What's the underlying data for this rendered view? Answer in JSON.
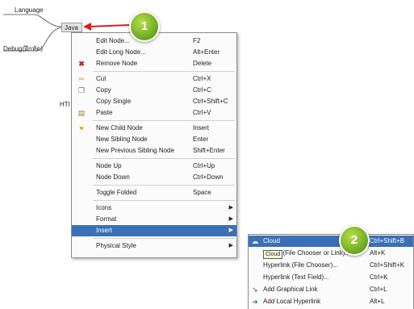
{
  "mindmap": {
    "nodes": {
      "language": "Language",
      "java": "Java",
      "debug": "Debug(ฝึกหัด)",
      "html_partial": "HTI"
    }
  },
  "annotations": {
    "badge1": "1",
    "badge2": "2",
    "arrow_color": "#d62020"
  },
  "context_menu": {
    "items": [
      {
        "label": "Edit Node...",
        "shortcut": "F2",
        "icon": ""
      },
      {
        "label": "Edit Long Node...",
        "shortcut": "Alt+Enter",
        "icon": ""
      },
      {
        "label": "Remove Node",
        "shortcut": "Delete",
        "icon": "remove-icon"
      },
      {
        "label": "Cut",
        "shortcut": "Ctrl+X",
        "icon": "cut-icon"
      },
      {
        "label": "Copy",
        "shortcut": "Ctrl+C",
        "icon": "copy-icon"
      },
      {
        "label": "Copy Single",
        "shortcut": "Ctrl+Shift+C",
        "icon": ""
      },
      {
        "label": "Paste",
        "shortcut": "Ctrl+V",
        "icon": "paste-icon"
      },
      {
        "label": "New Child Node",
        "shortcut": "Insert",
        "icon": "bulb-icon"
      },
      {
        "label": "New Sibling Node",
        "shortcut": "Enter",
        "icon": ""
      },
      {
        "label": "New Previous Sibling Node",
        "shortcut": "Shift+Enter",
        "icon": ""
      },
      {
        "label": "Node Up",
        "shortcut": "Ctrl+Up",
        "icon": ""
      },
      {
        "label": "Node Down",
        "shortcut": "Ctrl+Down",
        "icon": ""
      },
      {
        "label": "Toggle Folded",
        "shortcut": "Space",
        "icon": ""
      },
      {
        "label": "Icons",
        "shortcut": "",
        "icon": ""
      },
      {
        "label": "Format",
        "shortcut": "",
        "icon": ""
      },
      {
        "label": "Insert",
        "shortcut": "",
        "icon": ""
      },
      {
        "label": "Physical Style",
        "shortcut": "",
        "icon": ""
      }
    ],
    "selected": "Insert"
  },
  "insert_submenu": {
    "items": [
      {
        "label": "Cloud",
        "shortcut": "Ctrl+Shift+B",
        "icon": "cloud-icon"
      },
      {
        "label": "Image (File Chooser or Link)...",
        "shortcut": "Alt+K",
        "icon": ""
      },
      {
        "label": "Hyperlink (File Chooser)...",
        "shortcut": "Ctrl+Shift+K",
        "icon": ""
      },
      {
        "label": "Hyperlink (Text Field)...",
        "shortcut": "Ctrl+K",
        "icon": ""
      },
      {
        "label": "Add Graphical Link",
        "shortcut": "Ctrl+L",
        "icon": "graphical-link-icon"
      },
      {
        "label": "Add Local Hyperlink",
        "shortcut": "Alt+L",
        "icon": "local-link-icon"
      }
    ],
    "tooltip": "Cloud"
  }
}
